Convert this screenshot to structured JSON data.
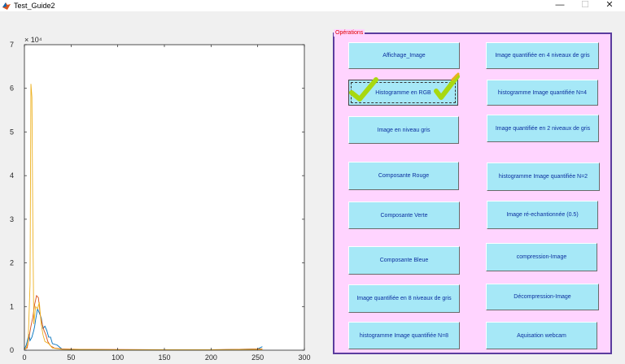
{
  "window": {
    "title": "Test_Guide2",
    "minimize_glyph": "—",
    "maximize_glyph": "☐",
    "close_glyph": "✕"
  },
  "panel": {
    "title": "Opérations",
    "buttons": [
      {
        "label": "Affichage_Image"
      },
      {
        "label": "Image quantifiée en 4 niveaux de gris"
      },
      {
        "label": "Histogramme en RGB"
      },
      {
        "label": "histogramme Image quantifiée N=4"
      },
      {
        "label": "Image en niveau gris"
      },
      {
        "label": "Image quantifiée en 2 niveaux de gris"
      },
      {
        "label": "Composante Rouge"
      },
      {
        "label": "histogramme Image quantifiée N=2"
      },
      {
        "label": "Composante Verte"
      },
      {
        "label": "Image ré-echantionnée (0.5)"
      },
      {
        "label": "Composante Bleue"
      },
      {
        "label": "compression-Image"
      },
      {
        "label": "Image quantifiée en 8 niveaux de gris"
      },
      {
        "label": "Décompression-Image"
      },
      {
        "label": "histogramme Image quantifiée N=8"
      },
      {
        "label": "Aquisation webcam"
      }
    ]
  },
  "colors": {
    "panel_bg": "#ffd4ff",
    "button_bg": "#a6e8f7",
    "button_text": "#0b2f9e",
    "checkmark": "#a8d810"
  },
  "chart_data": {
    "type": "line",
    "title": "",
    "xlabel": "",
    "ylabel": "",
    "exponent_label": "× 10⁴",
    "xlim": [
      0,
      300
    ],
    "ylim": [
      0,
      7
    ],
    "xticks": [
      "0",
      "50",
      "100",
      "150",
      "200",
      "250",
      "300"
    ],
    "yticks": [
      "0",
      "1",
      "2",
      "3",
      "4",
      "5",
      "6",
      "7"
    ],
    "series": [
      {
        "color": "#0072bd",
        "x": [
          0,
          2,
          4,
          5,
          6,
          8,
          10,
          11,
          12,
          14,
          16,
          18,
          20,
          22,
          24,
          26,
          28,
          30,
          35,
          40,
          50,
          100,
          200,
          250,
          255
        ],
        "y": [
          0.02,
          0.12,
          0.3,
          0.35,
          0.22,
          0.3,
          0.45,
          0.55,
          0.7,
          0.95,
          0.85,
          0.75,
          0.5,
          0.55,
          0.45,
          0.3,
          0.3,
          0.15,
          0.12,
          0.03,
          0.01,
          0.005,
          0.005,
          0.03,
          0.08
        ]
      },
      {
        "color": "#d95319",
        "x": [
          0,
          3,
          5,
          7,
          9,
          11,
          13,
          15,
          17,
          19,
          21,
          23,
          25,
          28,
          32,
          40,
          60,
          150,
          200,
          230,
          250,
          255
        ],
        "y": [
          0.02,
          0.05,
          0.3,
          0.55,
          0.75,
          1.05,
          1.25,
          1.2,
          0.8,
          0.6,
          0.45,
          0.35,
          0.2,
          0.1,
          0.05,
          0.03,
          0.02,
          0.01,
          0.01,
          0.02,
          0.03,
          0.03
        ]
      },
      {
        "color": "#edb120",
        "x": [
          0,
          2,
          4,
          6,
          7,
          8,
          9,
          10,
          11,
          12,
          14,
          16,
          18,
          20,
          22,
          26,
          30,
          40,
          100,
          200,
          255
        ],
        "y": [
          0.02,
          0.05,
          0.2,
          1.5,
          6.1,
          5.8,
          3.0,
          0.6,
          0.8,
          1.0,
          0.95,
          1.1,
          0.6,
          0.35,
          0.2,
          0.15,
          0.05,
          0.02,
          0.01,
          0.01,
          0.02
        ]
      }
    ]
  }
}
